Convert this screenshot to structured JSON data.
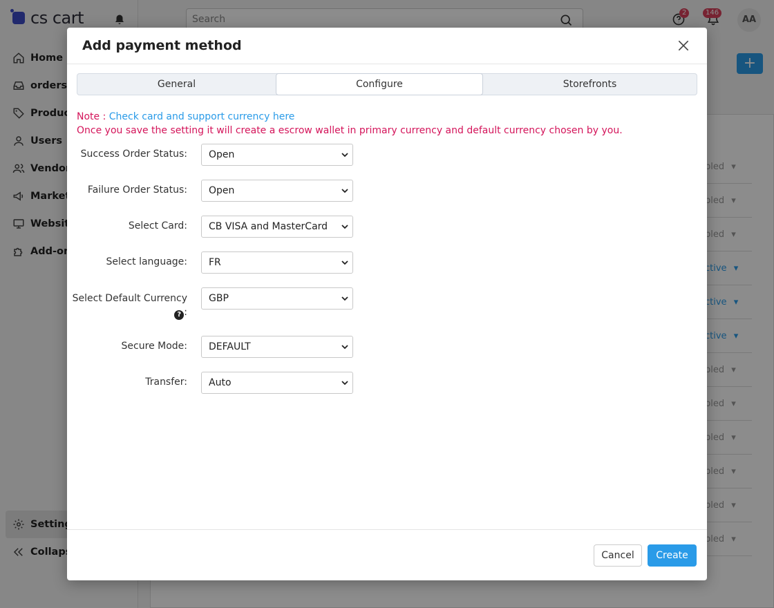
{
  "app": {
    "logo_text": "cs cart",
    "search_placeholder": "Search",
    "help_badge": "2",
    "notifications_badge": "146",
    "avatar_initials": "AA",
    "plus_label": "+"
  },
  "sidebar": {
    "items": [
      {
        "label": "Home",
        "icon": "home-icon"
      },
      {
        "label": "orders",
        "icon": "inbox-icon"
      },
      {
        "label": "Product",
        "icon": "tag-icon"
      },
      {
        "label": "Users",
        "icon": "user-icon"
      },
      {
        "label": "Vendors",
        "icon": "users-icon"
      },
      {
        "label": "Marketi",
        "icon": "megaphone-icon"
      },
      {
        "label": "Website",
        "icon": "monitor-icon"
      },
      {
        "label": "Add-ons",
        "icon": "puzzle-icon"
      }
    ],
    "settings_label": "Settings",
    "collapse_label": "Collapse"
  },
  "background_rows": [
    "bled",
    "bled",
    "bled",
    "ctive",
    "ctive",
    "ctive",
    "bled",
    "bled",
    "bled",
    "bled",
    "bled",
    "bled"
  ],
  "modal": {
    "title": "Add payment method",
    "tabs": [
      "General",
      "Configure",
      "Storefronts"
    ],
    "active_tab": "Configure",
    "note_prefix": "Note : ",
    "note_link": "Check card and support currency here",
    "note_text": "Once you save the setting it will create a escrow wallet in primary currency and default currency chosen by you.",
    "fields": {
      "success_label": "Success Order Status:",
      "success_value": "Open",
      "failure_label": "Failure Order Status:",
      "failure_value": "Open",
      "card_label": "Select Card:",
      "card_value": "CB VISA and MasterCard",
      "language_label": "Select language:",
      "language_value": "FR",
      "currency_label_line1": "Select Default Currency",
      "currency_label_suffix": ":",
      "currency_value": "GBP",
      "secure_label": "Secure Mode:",
      "secure_value": "DEFAULT",
      "transfer_label": "Transfer:",
      "transfer_value": "Auto"
    },
    "cancel_label": "Cancel",
    "create_label": "Create"
  },
  "colors": {
    "accent": "#2a9be8",
    "note": "#d4145a",
    "badge": "#d9415c"
  }
}
